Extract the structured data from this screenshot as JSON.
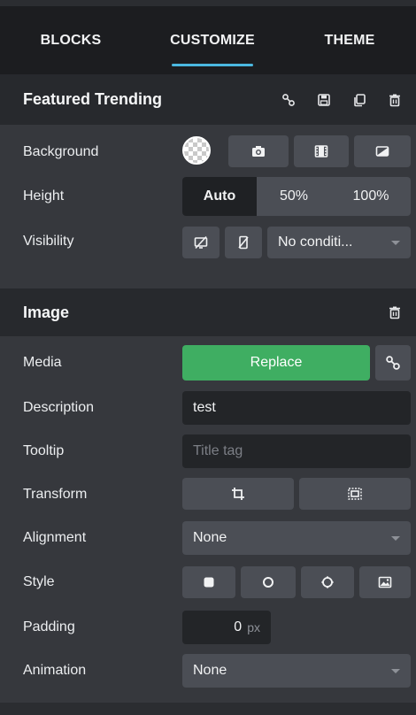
{
  "tabs": [
    {
      "label": "BLOCKS"
    },
    {
      "label": "CUSTOMIZE"
    },
    {
      "label": "THEME"
    }
  ],
  "section1": {
    "title": "Featured Trending",
    "icons": [
      "link-icon",
      "save-icon",
      "copy-icon",
      "trash-icon"
    ],
    "rows": {
      "background": "Background",
      "height": "Height",
      "visibility": "Visibility"
    },
    "height_options": [
      "Auto",
      "50%",
      "100%"
    ],
    "height_selected": "Auto",
    "visibility_select": "No conditi..."
  },
  "section2": {
    "title": "Image",
    "rows": {
      "media": "Media",
      "description": "Description",
      "tooltip": "Tooltip",
      "transform": "Transform",
      "alignment": "Alignment",
      "style": "Style",
      "padding": "Padding",
      "animation": "Animation"
    },
    "replace_label": "Replace",
    "description_value": "test",
    "tooltip_placeholder": "Title tag",
    "alignment_value": "None",
    "padding_value": "0",
    "padding_unit": "px",
    "animation_value": "None"
  },
  "colors": {
    "accent": "#4bb8e0",
    "replace_green": "#3fae62"
  }
}
